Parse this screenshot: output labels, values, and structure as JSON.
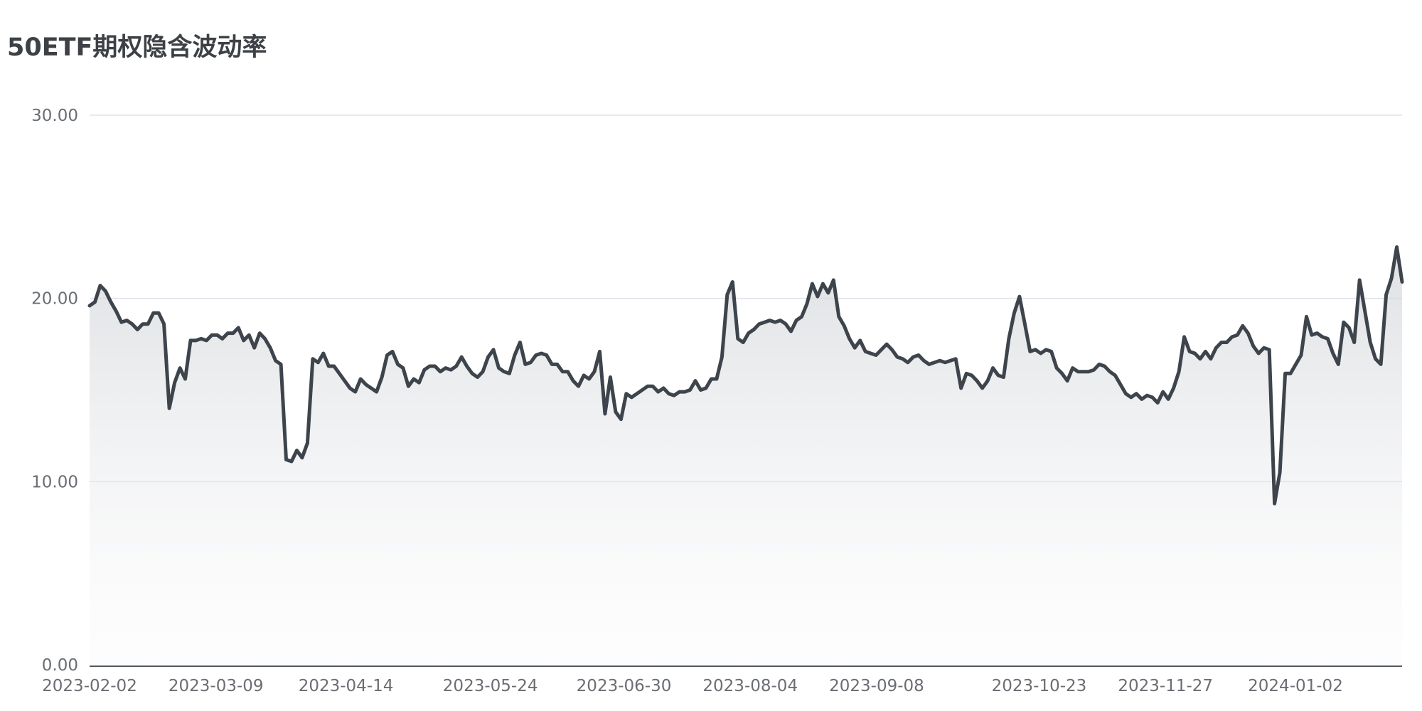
{
  "chart_data": {
    "type": "area",
    "title": "50ETF期权隐含波动率",
    "xlabel": "",
    "ylabel": "",
    "ylim": [
      0,
      30
    ],
    "yticks": [
      "0.00",
      "10.00",
      "20.00",
      "30.00"
    ],
    "xticks": [
      "2023-02-02",
      "2023-03-09",
      "2023-04-14",
      "2023-05-24",
      "2023-06-30",
      "2023-08-04",
      "2023-09-08",
      "2023-10-23",
      "2023-11-27",
      "2024-01-02"
    ],
    "grid": true,
    "legend": "none",
    "colors": {
      "line": "#3d444c",
      "grid": "#dfe3ea",
      "axis": "#555a60"
    },
    "series": [
      {
        "values": [
          19.6,
          19.8,
          20.7,
          20.4,
          19.8,
          19.3,
          18.7,
          18.8,
          18.6,
          18.3,
          18.6,
          18.6,
          19.2,
          19.2,
          18.6,
          14.0,
          15.4,
          16.2,
          15.6,
          17.7,
          17.7,
          17.8,
          17.7,
          18.0,
          18.0,
          17.8,
          18.1,
          18.1,
          18.4,
          17.7,
          18.0,
          17.3,
          18.1,
          17.8,
          17.3,
          16.6,
          16.4,
          11.2,
          11.1,
          11.7,
          11.3,
          12.1,
          16.7,
          16.5,
          17.0,
          16.3,
          16.3,
          15.9,
          15.5,
          15.1,
          14.9,
          15.6,
          15.3,
          15.1,
          14.9,
          15.7,
          16.9,
          17.1,
          16.4,
          16.2,
          15.2,
          15.6,
          15.4,
          16.1,
          16.3,
          16.3,
          16.0,
          16.2,
          16.1,
          16.3,
          16.8,
          16.3,
          15.9,
          15.7,
          16.0,
          16.8,
          17.2,
          16.2,
          16.0,
          15.9,
          16.9,
          17.6,
          16.4,
          16.5,
          16.9,
          17.0,
          16.9,
          16.4,
          16.4,
          16.0,
          16.0,
          15.5,
          15.2,
          15.8,
          15.6,
          16.0,
          17.1,
          13.7,
          15.7,
          13.8,
          13.4,
          14.8,
          14.6,
          14.8,
          15.0,
          15.2,
          15.2,
          14.9,
          15.1,
          14.8,
          14.7,
          14.9,
          14.9,
          15.0,
          15.5,
          15.0,
          15.1,
          15.6,
          15.6,
          16.8,
          20.2,
          20.9,
          17.8,
          17.6,
          18.1,
          18.3,
          18.6,
          18.7,
          18.8,
          18.7,
          18.8,
          18.6,
          18.2,
          18.8,
          19.0,
          19.7,
          20.8,
          20.1,
          20.8,
          20.3,
          21.0,
          19.0,
          18.5,
          17.8,
          17.3,
          17.7,
          17.1,
          17.0,
          16.9,
          17.2,
          17.5,
          17.2,
          16.8,
          16.7,
          16.5,
          16.8,
          16.9,
          16.6,
          16.4,
          16.5,
          16.6,
          16.5,
          16.6,
          16.7,
          15.1,
          15.9,
          15.8,
          15.5,
          15.1,
          15.5,
          16.2,
          15.8,
          15.7,
          17.8,
          19.2,
          20.1,
          18.6,
          17.1,
          17.2,
          17.0,
          17.2,
          17.1,
          16.2,
          15.9,
          15.5,
          16.2,
          16.0,
          16.0,
          16.0,
          16.1,
          16.4,
          16.3,
          16.0,
          15.8,
          15.3,
          14.8,
          14.6,
          14.8,
          14.5,
          14.7,
          14.6,
          14.3,
          14.9,
          14.5,
          15.1,
          16.0,
          17.9,
          17.1,
          17.0,
          16.7,
          17.1,
          16.7,
          17.3,
          17.6,
          17.6,
          17.9,
          18.0,
          18.5,
          18.1,
          17.4,
          17.0,
          17.3,
          17.2,
          8.8,
          10.5,
          15.9,
          15.9,
          16.4,
          16.9,
          19.0,
          18.0,
          18.1,
          17.9,
          17.8,
          17.0,
          16.4,
          18.7,
          18.4,
          17.6,
          21.0,
          19.3,
          17.6,
          16.7,
          16.4,
          20.2,
          21.1,
          22.8,
          20.9
        ]
      }
    ]
  }
}
